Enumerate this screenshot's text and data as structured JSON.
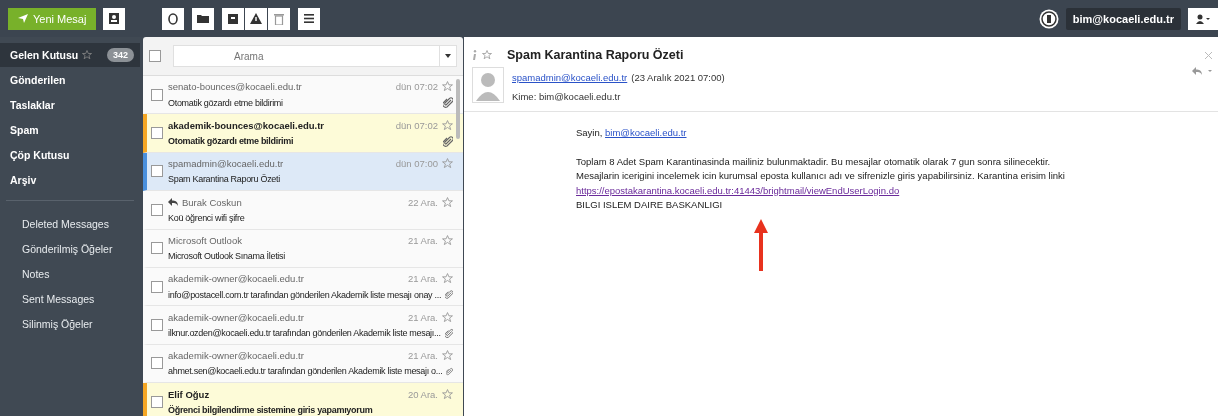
{
  "toolbar": {
    "compose_button": "Yeni Mesaj"
  },
  "account": {
    "email": "bim@kocaeli.edu.tr"
  },
  "folders": [
    {
      "label": "Gelen Kutusu",
      "count": "342",
      "selected": true
    },
    {
      "label": "Gönderilen",
      "selected": false
    },
    {
      "label": "Taslaklar",
      "selected": false
    },
    {
      "label": "Spam",
      "selected": false
    },
    {
      "label": "Çöp Kutusu",
      "selected": false
    },
    {
      "label": "Arşiv",
      "selected": false
    }
  ],
  "subfolders": [
    {
      "label": "Deleted Messages",
      "selected": false
    },
    {
      "label": "Gönderilmiş Öğeler",
      "selected": false
    },
    {
      "label": "Notes",
      "selected": false
    },
    {
      "label": "Sent Messages",
      "selected": false
    },
    {
      "label": "Silinmiş Öğeler",
      "selected": false
    }
  ],
  "message_list": {
    "select_all_checked": false,
    "search": {
      "placeholder": "Arama"
    },
    "messages": [
      {
        "sender": "senato-bounces@kocaeli.edu.tr",
        "subject": "Otomatik gözardı etme bildirimi",
        "date": "dün 07:02",
        "checked": false,
        "unread": false,
        "flagged": false,
        "selected": false,
        "attachment": true,
        "replied": false
      },
      {
        "sender": "akademik-bounces@kocaeli.edu.tr",
        "subject": "Otomatik gözardı etme bildirimi",
        "date": "dün 07:02",
        "checked": false,
        "unread": true,
        "flagged": true,
        "selected": false,
        "attachment": true,
        "replied": false
      },
      {
        "sender": "spamadmin@kocaeli.edu.tr",
        "subject": "Spam Karantina Raporu Özeti",
        "date": "dün 07:00",
        "checked": false,
        "unread": false,
        "flagged": false,
        "selected": true,
        "attachment": false,
        "replied": false
      },
      {
        "sender": "Burak Coskun",
        "subject": "Koü öğrenci wifi şifre",
        "date": "22 Ara.",
        "checked": false,
        "unread": false,
        "flagged": false,
        "selected": false,
        "attachment": false,
        "replied": true
      },
      {
        "sender": "Microsoft Outlook",
        "subject": "Microsoft Outlook Sınama İletisi",
        "date": "21 Ara.",
        "checked": false,
        "unread": false,
        "flagged": false,
        "selected": false,
        "attachment": false,
        "replied": false
      },
      {
        "sender": "akademik-owner@kocaeli.edu.tr",
        "subject": "info@postacell.com.tr tarafından gönderilen Akademik liste mesajı onay ...",
        "date": "21 Ara.",
        "checked": false,
        "unread": false,
        "flagged": false,
        "selected": false,
        "attachment": true,
        "replied": false
      },
      {
        "sender": "akademik-owner@kocaeli.edu.tr",
        "subject": "ilknur.ozden@kocaeli.edu.tr tarafından gönderilen Akademik liste mesajı...",
        "date": "21 Ara.",
        "checked": false,
        "unread": false,
        "flagged": false,
        "selected": false,
        "attachment": true,
        "replied": false
      },
      {
        "sender": "akademik-owner@kocaeli.edu.tr",
        "subject": "ahmet.sen@kocaeli.edu.tr tarafından gönderilen Akademik liste mesajı o...",
        "date": "21 Ara.",
        "checked": false,
        "unread": false,
        "flagged": false,
        "selected": false,
        "attachment": true,
        "replied": false
      },
      {
        "sender": "Elif Oğuz",
        "subject": "Öğrenci bilgilendirme sistemine giris yapamıyorum",
        "date": "20 Ara.",
        "checked": false,
        "unread": true,
        "flagged": true,
        "selected": false,
        "attachment": false,
        "replied": false
      }
    ]
  },
  "message": {
    "subject": "Spam Karantina Raporu Özeti",
    "from": "spamadmin@kocaeli.edu.tr",
    "date": "(23 Aralık 2021 07:00)",
    "to": "Kime: bim@kocaeli.edu.tr",
    "body": {
      "greeting": "Sayin,",
      "greeting_link": "bim@kocaeli.edu.tr",
      "lines": [
        "Toplam 8 Adet Spam Karantinasinda mailiniz bulunmaktadir. Bu mesajlar otomatik olarak 7 gun sonra silinecektir.",
        "Mesajlarin icerigini incelemek icin kurumsal eposta kullanıcı adı ve sifrenizle giris yapabilirsiniz. Karantina erisim linki"
      ],
      "link": "https://epostakarantina.kocaeli.edu.tr:41443/brightmail/viewEndUserLogin.do",
      "signature": "BILGI ISLEM DAIRE BASKANLIGI"
    }
  }
}
